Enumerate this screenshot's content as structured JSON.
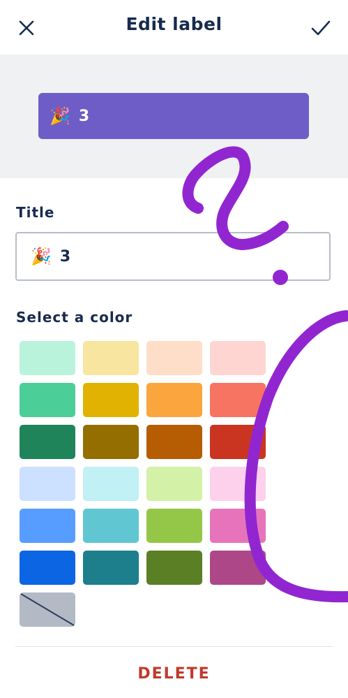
{
  "header": {
    "title": "Edit label",
    "close_icon": "close-icon",
    "confirm_icon": "check-icon"
  },
  "preview": {
    "emoji": "🎉",
    "text": "3",
    "color": "#6e5dc6"
  },
  "form": {
    "title_label": "Title",
    "title_value": "3",
    "title_emoji": "🎉",
    "color_label": "Select a color"
  },
  "colors": [
    [
      "#baf3db",
      "#f8e6a0",
      "#fedec8",
      "#ffd5d2"
    ],
    [
      "#4bce97",
      "#e2b203",
      "#faa53d",
      "#f87462"
    ],
    [
      "#1f845a",
      "#946f00",
      "#b65c02",
      "#ca3521"
    ],
    [
      "#cce0ff",
      "#c1f0f5",
      "#d3f1a7",
      "#fdd0ec"
    ],
    [
      "#579dff",
      "#60c6d2",
      "#94c748",
      "#e774bb"
    ],
    [
      "#0c66e4",
      "#1d7f8c",
      "#5b7f24",
      "#ae4787"
    ]
  ],
  "no_color_icon": "no-color-icon",
  "footer": {
    "delete_label": "DELETE"
  },
  "scribble_color": "#9126d1"
}
